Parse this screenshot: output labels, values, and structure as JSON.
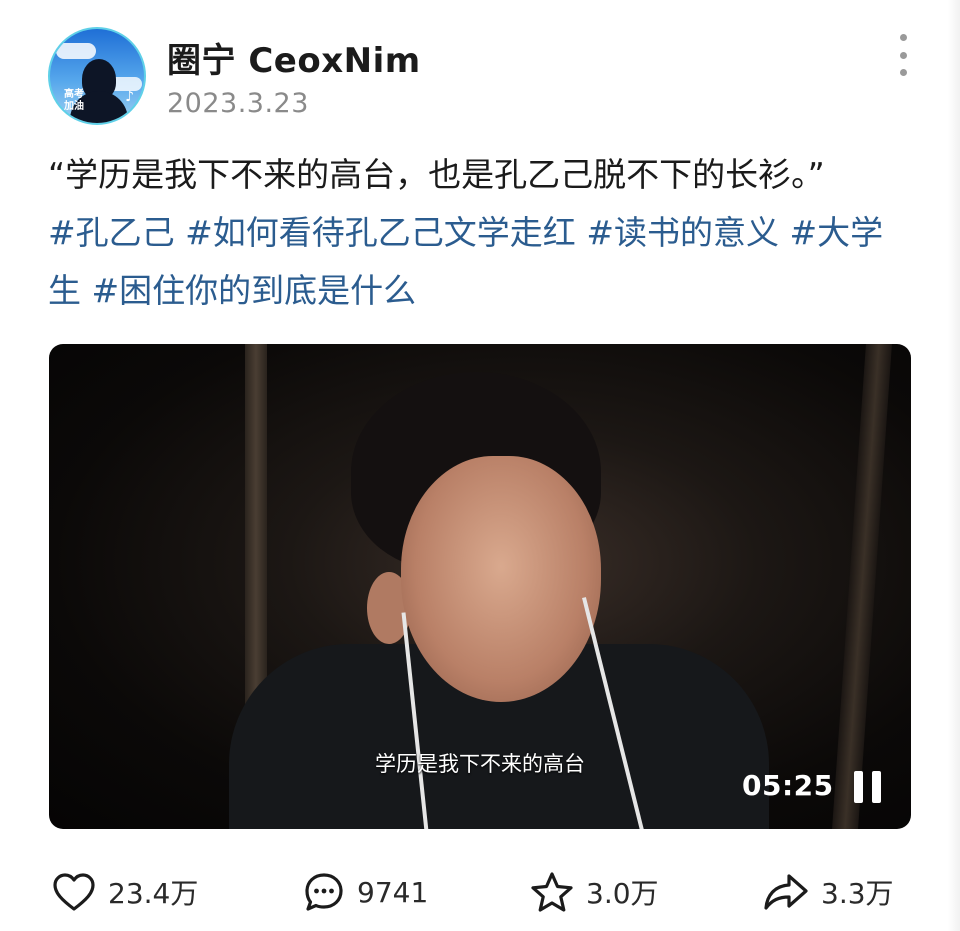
{
  "post": {
    "author": "圈宁 CeoxNim",
    "date": "2023.3.23",
    "avatar_badge": "高考\n加油",
    "quote": "“学历是我下不来的高台，也是孔乙己脱不下的长衫。”",
    "hashtags": [
      "#孔乙己",
      "#如何看待孔乙己文学走红",
      "#读书的意义",
      "#大学生",
      "#困住你的到底是什么"
    ]
  },
  "video": {
    "subtitle": "学历是我下不来的高台",
    "duration": "05:25",
    "state_icon": "pause-icon"
  },
  "actions": {
    "likes": "23.4万",
    "comments": "9741",
    "favorites": "3.0万",
    "shares": "3.3万"
  },
  "colors": {
    "hashtag": "#2b5c8f",
    "secondary_text": "#8a8a8a"
  }
}
